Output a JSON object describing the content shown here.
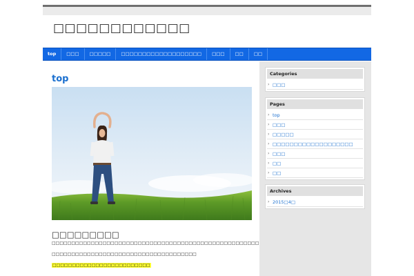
{
  "site": {
    "title": "□□□□□□□□□□□□"
  },
  "nav": {
    "items": [
      {
        "label": "top",
        "active": true
      },
      {
        "label": "□□□"
      },
      {
        "label": "□□□□□"
      },
      {
        "label": "□□□□□□□□□□□□□□□□□□□"
      },
      {
        "label": "□□□"
      },
      {
        "label": "□□"
      },
      {
        "label": "□□"
      }
    ]
  },
  "post": {
    "title": "top",
    "image_icon": "photo-woman-in-field",
    "section_heading": "□□□□□□□□□",
    "paragraphs": [
      "□□□□□□□□□□□□□□□□□□□□□□□□□□□□□□□□□□□□□□□□□□□□□□□□□□□□□□□□□□□□□□□□□□□□□□",
      "□□□□□□□□□□□□□□□□□□□□□□□□□□□□□□□□□□□□□"
    ],
    "highlight": "□□□□□□□□□□□□□□□□□□□□□□□□□"
  },
  "sidebar": {
    "categories": {
      "title": "Categories",
      "items": [
        "□□□"
      ]
    },
    "pages": {
      "title": "Pages",
      "items": [
        "top",
        "□□□",
        "□□□□□",
        "□□□□□□□□□□□□□□□□□□□",
        "□□□",
        "□□",
        "□□"
      ]
    },
    "archives": {
      "title": "Archives",
      "items": [
        "2015□4□"
      ]
    }
  },
  "colors": {
    "nav_bg": "#1268e4",
    "link": "#1a6fcf",
    "highlight": "#ffff30",
    "sidebar_bg": "#e6e6e6"
  }
}
